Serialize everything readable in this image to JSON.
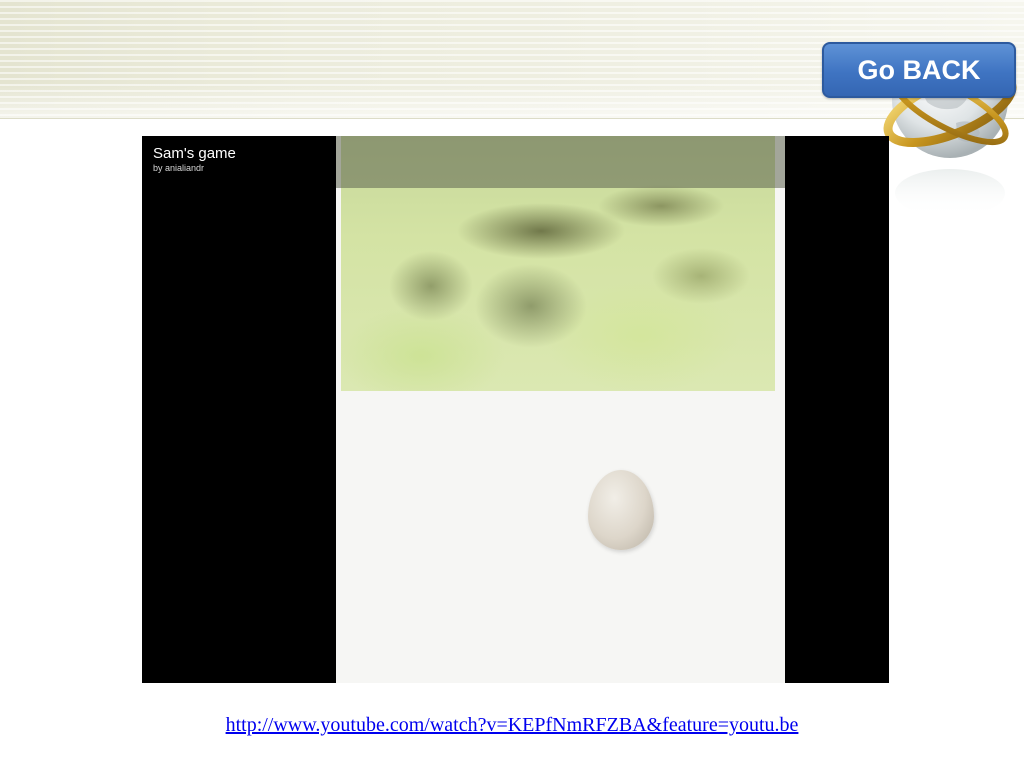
{
  "header": {
    "back_button_label": "Go BACK"
  },
  "video": {
    "title": "Sam's game",
    "author": "by anialiandr"
  },
  "link": {
    "url_text": "http://www.youtube.com/watch?v=KEPfNmRFZBA&feature=youtu.be"
  },
  "colors": {
    "button_blue": "#3f74c2",
    "link_blue": "#0000ee",
    "video_bg": "#000000"
  },
  "icons": [
    "globe-icon",
    "egg-icon"
  ]
}
